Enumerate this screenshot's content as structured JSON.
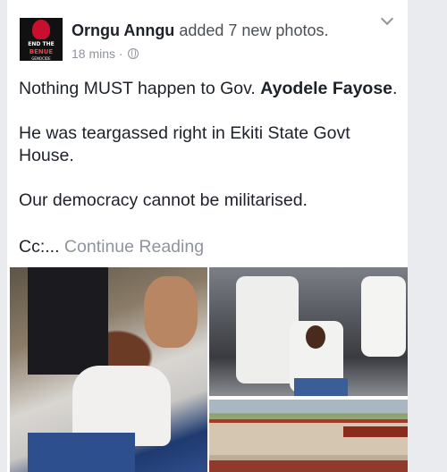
{
  "post": {
    "author": "Orngu Anngu",
    "action": "added 7 new photos.",
    "time": "18 mins",
    "dot": "·",
    "paragraphs": {
      "p1_prefix": "Nothing MUST happen to Gov. ",
      "p1_bold": "Ayodele Fayose",
      "p1_suffix": ".",
      "p2_line1": "He was teargassed right in Ekiti State Govt",
      "p2_line2": "House.",
      "p3": "Our democracy cannot be militarised.",
      "p4": "Cc:... ",
      "continue": "Continue Reading"
    },
    "avatar": {
      "line1": "END THE",
      "line2": "BENUE",
      "line3": "GENOCIDE"
    }
  }
}
